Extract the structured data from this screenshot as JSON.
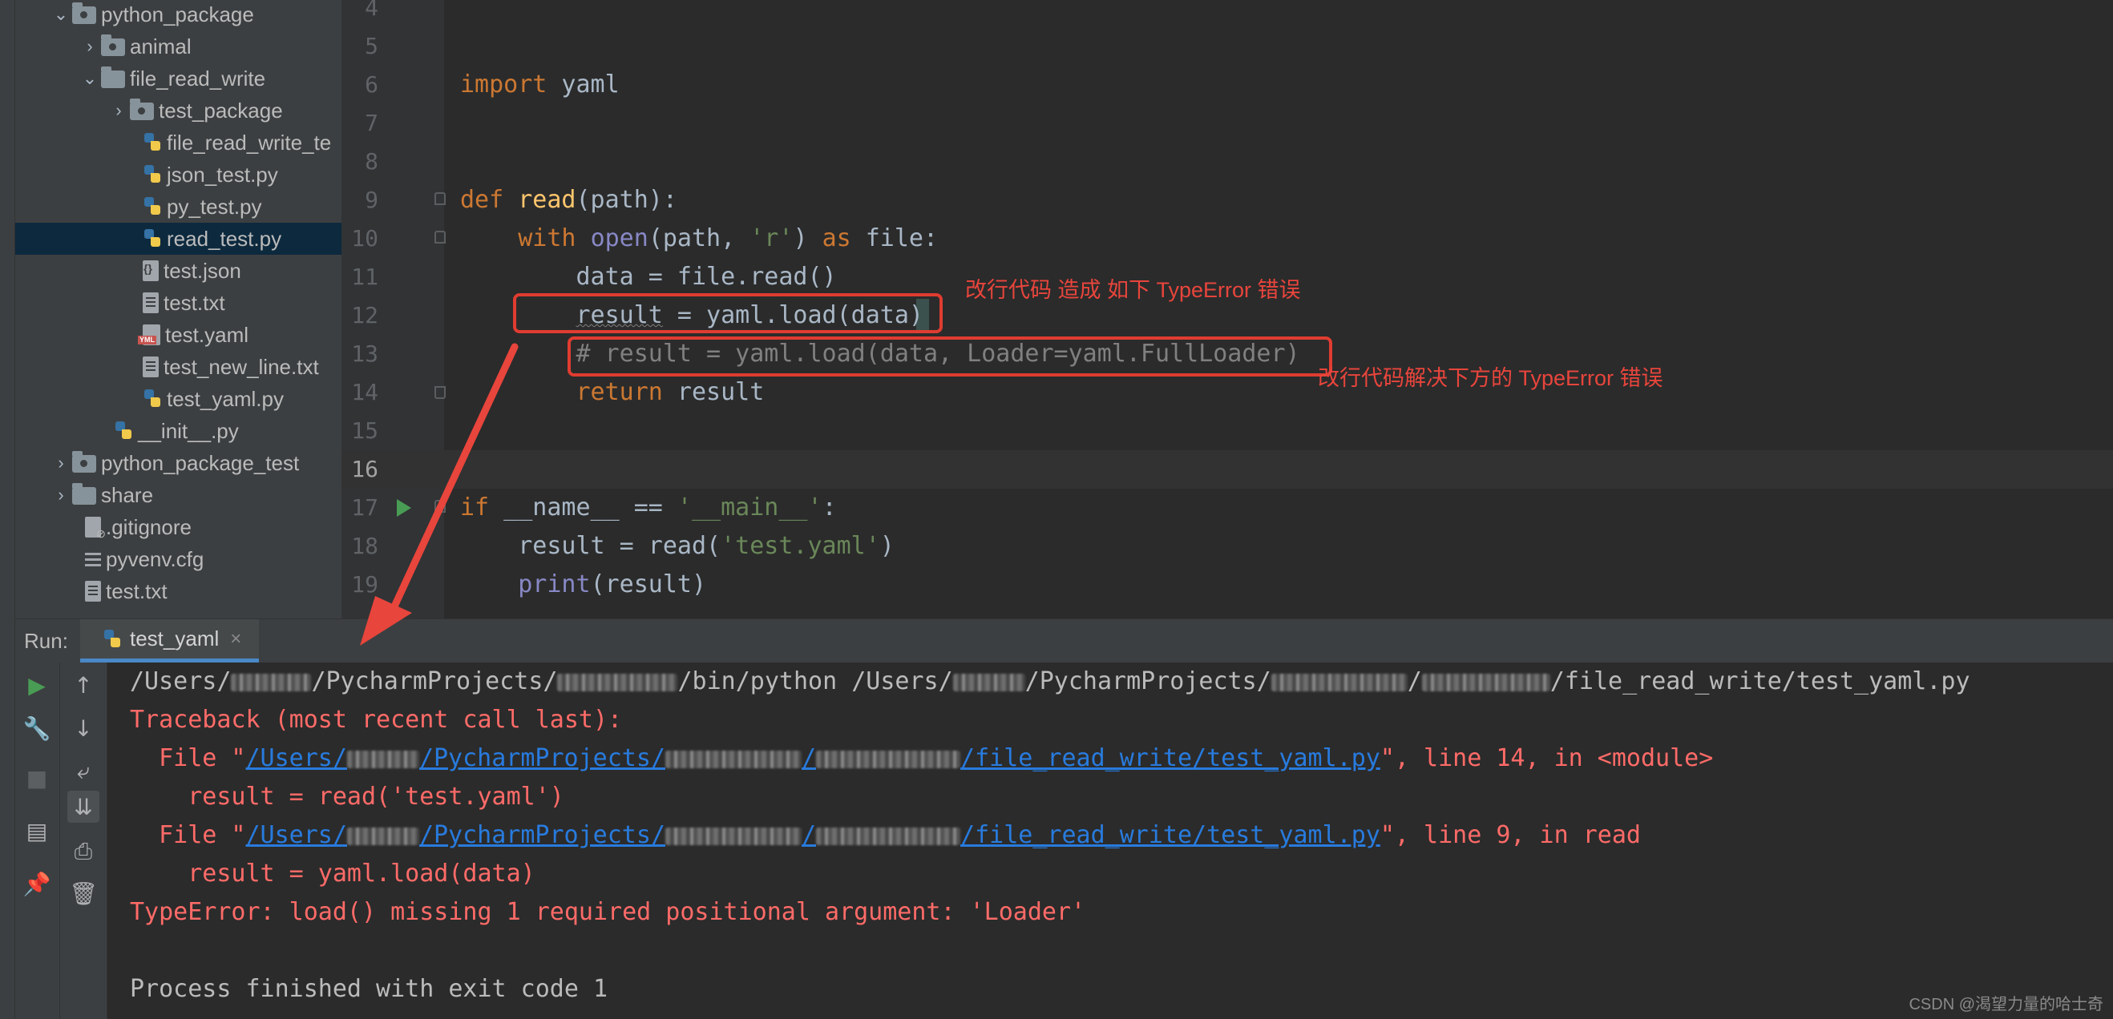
{
  "project_tree": {
    "items": [
      {
        "label": "python_package",
        "type": "package",
        "expanded": true
      },
      {
        "label": "animal",
        "type": "package",
        "expanded": false
      },
      {
        "label": "file_read_write",
        "type": "folder",
        "expanded": true
      },
      {
        "label": "test_package",
        "type": "package",
        "expanded": false
      },
      {
        "label": "file_read_write_te",
        "type": "py"
      },
      {
        "label": "json_test.py",
        "type": "py"
      },
      {
        "label": "py_test.py",
        "type": "py"
      },
      {
        "label": "read_test.py",
        "type": "py",
        "selected": true
      },
      {
        "label": "test.json",
        "type": "json"
      },
      {
        "label": "test.txt",
        "type": "txt"
      },
      {
        "label": "test.yaml",
        "type": "yaml"
      },
      {
        "label": "test_new_line.txt",
        "type": "txt"
      },
      {
        "label": "test_yaml.py",
        "type": "py"
      },
      {
        "label": "__init__.py",
        "type": "py"
      },
      {
        "label": "python_package_test",
        "type": "package",
        "expanded": false
      },
      {
        "label": "share",
        "type": "folder",
        "expanded": false
      },
      {
        "label": ".gitignore",
        "type": "git"
      },
      {
        "label": "pyvenv.cfg",
        "type": "cfg"
      },
      {
        "label": "test.txt",
        "type": "txt"
      }
    ]
  },
  "editor": {
    "lines": [
      {
        "num": "4",
        "text": ""
      },
      {
        "num": "5",
        "text": ""
      },
      {
        "num": "6",
        "text": "import yaml"
      },
      {
        "num": "7",
        "text": ""
      },
      {
        "num": "8",
        "text": ""
      },
      {
        "num": "9",
        "text": "def read(path):"
      },
      {
        "num": "10",
        "text": "    with open(path, 'r') as file:"
      },
      {
        "num": "11",
        "text": "        data = file.read()"
      },
      {
        "num": "12",
        "text": "        result = yaml.load(data)"
      },
      {
        "num": "13",
        "text": "        # result = yaml.load(data, Loader=yaml.FullLoader)"
      },
      {
        "num": "14",
        "text": "        return result"
      },
      {
        "num": "15",
        "text": ""
      },
      {
        "num": "16",
        "text": ""
      },
      {
        "num": "17",
        "text": "if __name__ == '__main__':"
      },
      {
        "num": "18",
        "text": "    result = read('test.yaml')"
      },
      {
        "num": "19",
        "text": "    print(result)"
      }
    ],
    "annotations": {
      "line12_note": "改行代码 造成 如下 TypeError 错误",
      "line13_note": "改行代码解决下方的 TypeError 错误"
    }
  },
  "run_panel": {
    "label": "Run:",
    "tab_label": "test_yaml",
    "tab_close": "×",
    "console": {
      "cmd_a": "/Users/",
      "cmd_b": "/PycharmProjects/",
      "cmd_c": "/bin/python /Users/",
      "cmd_d": "/PycharmProjects/",
      "cmd_e": "/",
      "cmd_f": "/file_read_write/test_yaml.py",
      "traceback": "Traceback (most recent call last):",
      "frame1_prefix": "  File \"",
      "frame1_link_a": "/Users/",
      "frame1_link_b": "/PycharmProjects/",
      "frame1_link_c": "/",
      "frame1_link_d": "/file_read_write/test_yaml.py",
      "frame1_suffix": "\", line 14, in <module>",
      "frame1_code": "    result = read('test.yaml')",
      "frame2_prefix": "  File \"",
      "frame2_link_a": "/Users/",
      "frame2_link_b": "/PycharmProjects/",
      "frame2_link_c": "/",
      "frame2_link_d": "/file_read_write/test_yaml.py",
      "frame2_suffix": "\", line 9, in read",
      "frame2_code": "    result = yaml.load(data)",
      "error": "TypeError: load() missing 1 required positional argument: 'Loader'",
      "exit": "Process finished with exit code 1"
    }
  },
  "watermark": "CSDN @渴望力量的哈士奇",
  "colors": {
    "accent_annotation": "#e03c31",
    "console_error": "#ff6b68",
    "console_link": "#287bde",
    "keyword": "#cc7832"
  }
}
